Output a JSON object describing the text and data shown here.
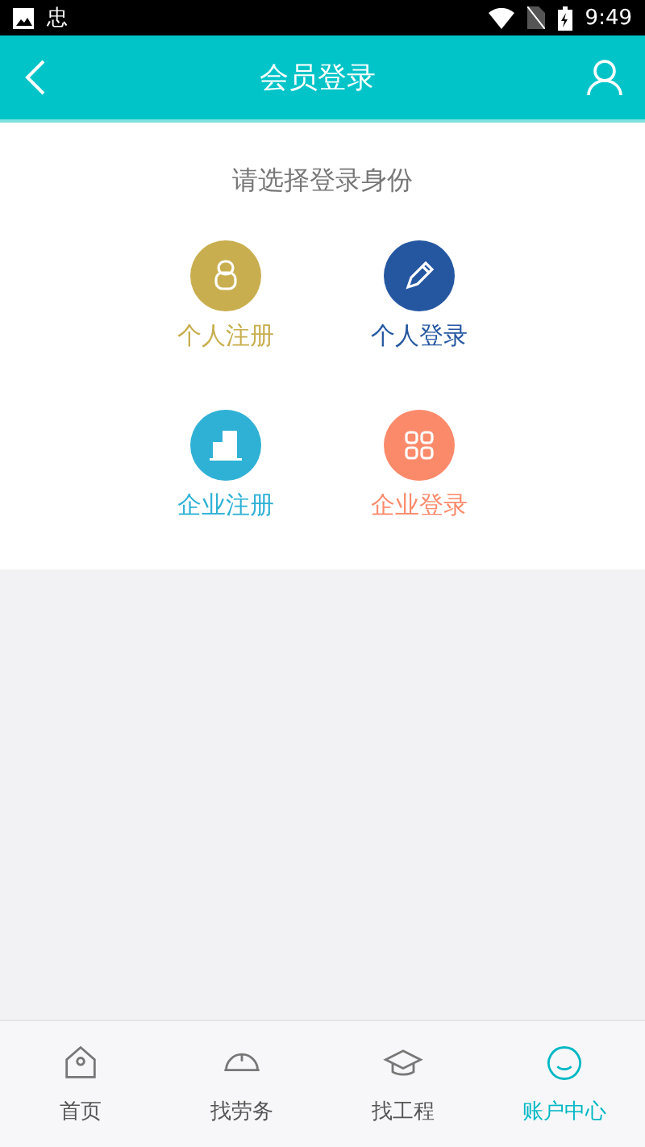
{
  "status_bar": {
    "time": "9:49",
    "notification_glyph": "忠"
  },
  "header": {
    "title": "会员登录"
  },
  "prompt": "请选择登录身份",
  "options": [
    {
      "kind": "person",
      "label": "个人注册",
      "color": "#c8ae4e"
    },
    {
      "kind": "pencil",
      "label": "个人登录",
      "color": "#2557a1"
    },
    {
      "kind": "building",
      "label": "企业注册",
      "color": "#2fb1d6"
    },
    {
      "kind": "grid",
      "label": "企业登录",
      "color": "#fb8a6b"
    }
  ],
  "tabs": [
    {
      "kind": "home",
      "label": "首页",
      "selected": false
    },
    {
      "kind": "helmet",
      "label": "找劳务",
      "selected": false
    },
    {
      "kind": "cap",
      "label": "找工程",
      "selected": false
    },
    {
      "kind": "face",
      "label": "账户中心",
      "selected": true
    }
  ]
}
